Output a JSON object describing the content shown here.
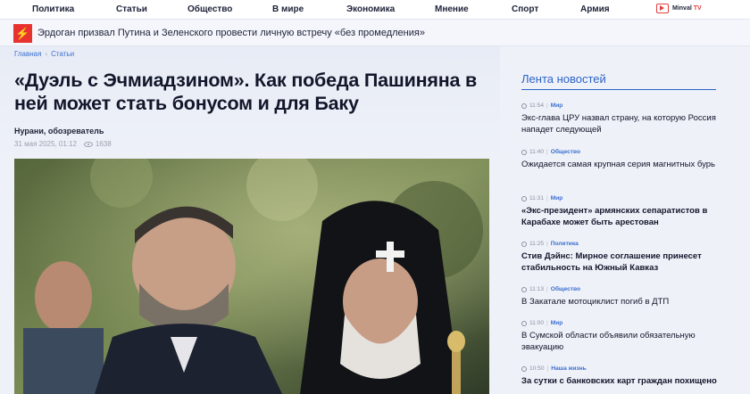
{
  "nav": {
    "items": [
      "Политика",
      "Статьи",
      "Общество",
      "В мире",
      "Экономика",
      "Мнение",
      "Спорт",
      "Армия"
    ],
    "tv_brand": "Minval",
    "tv_suffix": "TV"
  },
  "breaking": {
    "headline": "Эрдоган призвал Путина и Зеленского провести личную встречу «без промедления»"
  },
  "breadcrumb": {
    "home": "Главная",
    "section": "Статьи"
  },
  "article": {
    "title": "«Дуэль с Эчмиадзином». Как победа Пашиняна в ней может стать бонусом и для Баку",
    "author": "Нурани, обозреватель",
    "date": "31 мая 2025, 01:12",
    "views": "1638"
  },
  "sidebar": {
    "title": "Лента новостей",
    "items": [
      {
        "time": "11:54",
        "category": "Мир",
        "text": "Экс-глава ЦРУ назвал страну, на которую Россия нападет следующей",
        "bold": false
      },
      {
        "time": "11:40",
        "category": "Общество",
        "text": "Ожидается самая крупная серия магнитных бурь",
        "bold": false
      },
      {
        "time": "11:31",
        "category": "Мир",
        "text": "«Экс-президент» армянских сепаратистов в Карабахе может быть арестован",
        "bold": true
      },
      {
        "time": "11:25",
        "category": "Политика",
        "text": "Стив Дэйнс: Мирное соглашение принесет стабильность на Южный Кавказ",
        "bold": true
      },
      {
        "time": "11:13",
        "category": "Общество",
        "text": "В Закатале мотоциклист погиб в ДТП",
        "bold": false
      },
      {
        "time": "11:00",
        "category": "Мир",
        "text": "В Сумской области объявили обязательную эвакуацию",
        "bold": false
      },
      {
        "time": "10:50",
        "category": "Наша жизнь",
        "text": "За сутки с банковских карт граждан похищено",
        "bold": true
      }
    ]
  }
}
